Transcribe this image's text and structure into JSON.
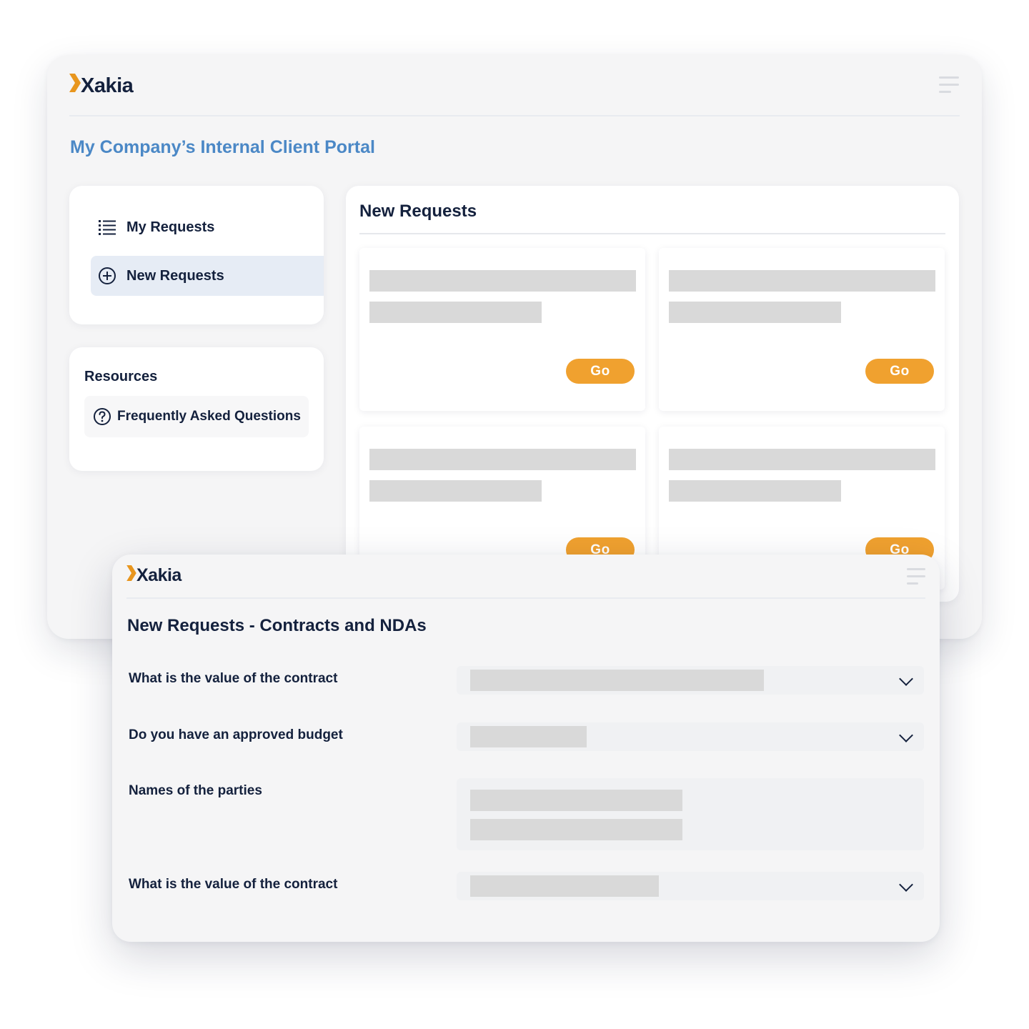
{
  "brand": {
    "name": "Xakia",
    "accent": "#e8961e",
    "primary": "#14213d"
  },
  "portal": {
    "title": "My Company’s Internal Client Portal",
    "nav": [
      {
        "label": "My Requests",
        "icon": "list-icon",
        "active": false
      },
      {
        "label": "New Requests",
        "icon": "plus-circle-icon",
        "active": true
      }
    ],
    "resources": {
      "title": "Resources",
      "items": [
        {
          "label": "Frequently Asked Questions",
          "icon": "question-circle-icon"
        }
      ]
    },
    "new_requests": {
      "title": "New Requests",
      "cards": [
        {
          "button": "Go"
        },
        {
          "button": "Go"
        },
        {
          "button": "Go"
        },
        {
          "button": "Go"
        }
      ]
    }
  },
  "form": {
    "title": "New Requests - Contracts and NDAs",
    "fields": [
      {
        "label": "What is the value of the contract",
        "type": "select"
      },
      {
        "label": "Do you have an approved budget",
        "type": "select"
      },
      {
        "label": "Names of the parties",
        "type": "textarea"
      },
      {
        "label": "What is the value of the contract",
        "type": "select"
      }
    ]
  },
  "colors": {
    "button": "#f0a12f",
    "portal_title": "#4b88c6",
    "active_nav": "#e6ecf5"
  }
}
